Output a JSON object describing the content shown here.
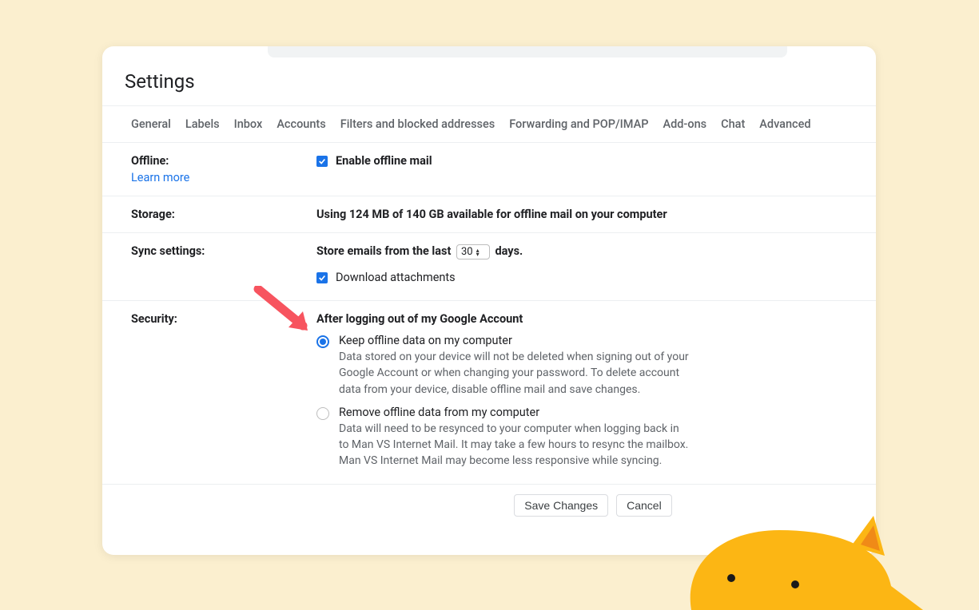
{
  "page": {
    "title": "Settings"
  },
  "tabs": {
    "general": "General",
    "labels": "Labels",
    "inbox": "Inbox",
    "accounts": "Accounts",
    "filters": "Filters and blocked addresses",
    "forwarding": "Forwarding and POP/IMAP",
    "addons": "Add-ons",
    "chat": "Chat",
    "advanced": "Advanced"
  },
  "offline": {
    "label": "Offline:",
    "learn_more": "Learn more",
    "enable": "Enable offline mail"
  },
  "storage": {
    "label": "Storage:",
    "value": "Using 124 MB of 140 GB available for offline mail on your computer"
  },
  "sync": {
    "label": "Sync settings:",
    "prefix": "Store emails from the last",
    "value": "30",
    "suffix": "days.",
    "download": "Download attachments"
  },
  "security": {
    "label": "Security:",
    "heading": "After logging out of my Google Account",
    "keep": {
      "title": "Keep offline data on my computer",
      "desc": "Data stored on your device will not be deleted when signing out of your Google Account or when changing your password. To delete account data from your device, disable offline mail and save changes."
    },
    "remove": {
      "title": "Remove offline data from my computer",
      "desc": "Data will need to be resynced to your computer when logging back in to Man VS Internet Mail. It may take a few hours to resync the mailbox. Man VS Internet Mail may become less responsive while syncing."
    }
  },
  "actions": {
    "save": "Save Changes",
    "cancel": "Cancel"
  }
}
